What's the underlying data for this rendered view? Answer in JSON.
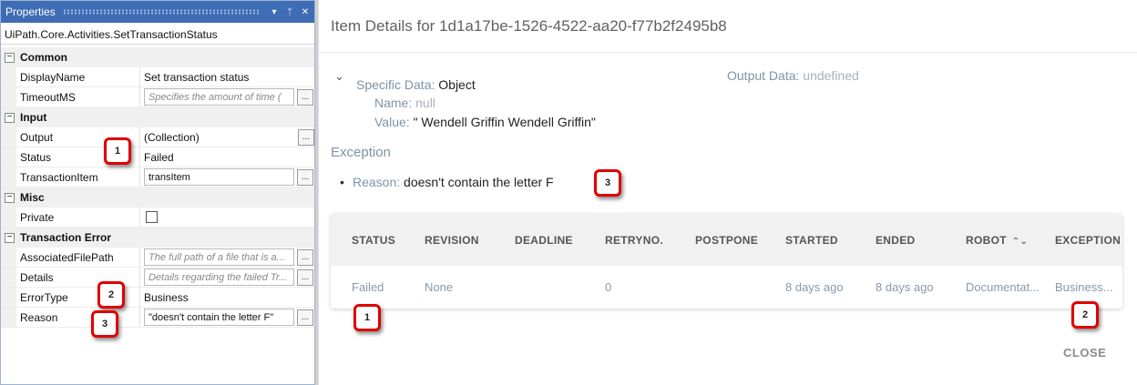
{
  "properties": {
    "title": "Properties",
    "subtitle": "UiPath.Core.Activities.SetTransactionStatus",
    "pin_glyph": "▾",
    "pin2_glyph": "ᛘ",
    "close_glyph": "✕",
    "categories": {
      "common": "Common",
      "input": "Input",
      "misc": "Misc",
      "transaction_error": "Transaction Error"
    },
    "rows": {
      "display_name": {
        "name": "DisplayName",
        "value": "Set transaction status"
      },
      "timeout": {
        "name": "TimeoutMS",
        "placeholder": "Specifies the amount of time ("
      },
      "output": {
        "name": "Output",
        "value": "(Collection)"
      },
      "status": {
        "name": "Status",
        "value": "Failed"
      },
      "transaction_item": {
        "name": "TransactionItem",
        "value": "transItem"
      },
      "private": {
        "name": "Private"
      },
      "associated_file": {
        "name": "AssociatedFilePath",
        "placeholder": "The full path of a file that is a..."
      },
      "details": {
        "name": "Details",
        "placeholder": "Details regarding the failed Tr..."
      },
      "error_type": {
        "name": "ErrorType",
        "value": "Business"
      },
      "reason": {
        "name": "Reason",
        "value": "\"doesn't contain the letter F\""
      }
    },
    "ellipsis": "...",
    "toggle_glyph": "⊟"
  },
  "badges": {
    "one": "1",
    "two": "2",
    "three": "3"
  },
  "dialog": {
    "title": "Item Details for 1d1a17be-1526-4522-aa20-f77b2f2495b8",
    "chevron": "⌄",
    "specific_label": "Specific Data:",
    "specific_value": "Object",
    "name_label": "Name:",
    "name_value": "null",
    "value_label": "Value:",
    "value_value": "\" Wendell Griffin Wendell Griffin\"",
    "output_label": "Output Data:",
    "output_value": "undefined",
    "exception_title": "Exception",
    "bullet": "•",
    "reason_label": "Reason:",
    "reason_value": "doesn't contain the letter F",
    "table": {
      "headers": [
        "STATUS",
        "REVISION",
        "DEADLINE",
        "RETRYNO.",
        "POSTPONE",
        "STARTED",
        "ENDED",
        "ROBOT",
        "EXCEPTION"
      ],
      "sort_glyph": "⌃⌄",
      "row": [
        "Failed",
        "None",
        "",
        "0",
        "",
        "8 days ago",
        "8 days ago",
        "Documentat...",
        "Business..."
      ]
    },
    "close_label": "CLOSE"
  },
  "colors": {
    "accent": "#3e6db5",
    "badge_border": "#e00000",
    "label": "#7e93a8"
  }
}
